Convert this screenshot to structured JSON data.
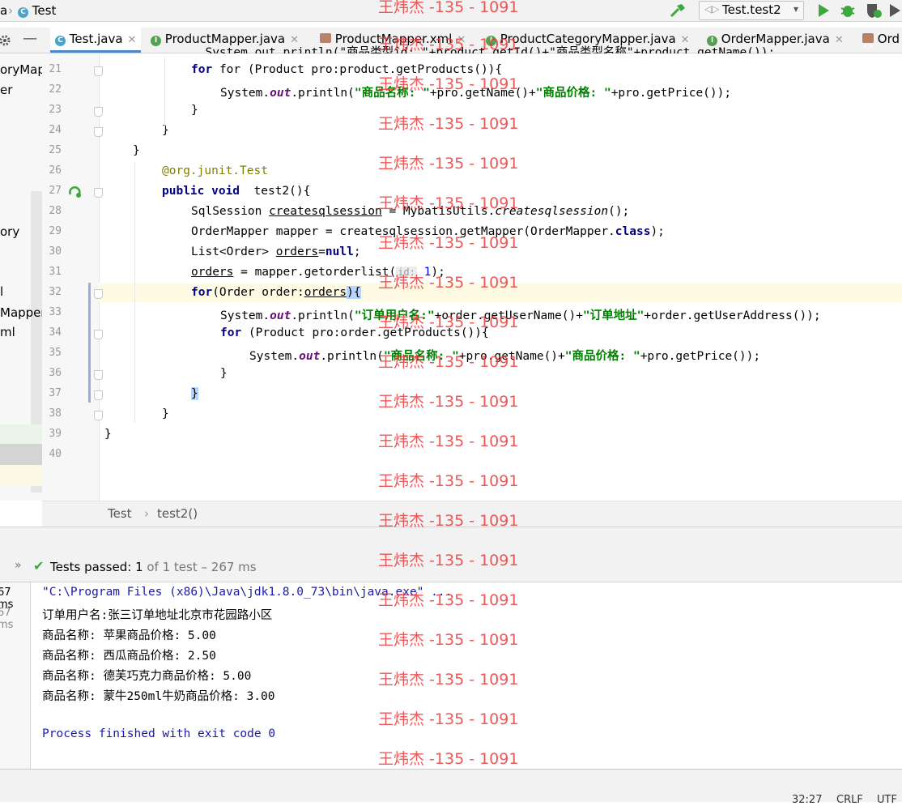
{
  "navbar": {
    "crumb_prev": "a",
    "crumb_file": "Test",
    "run_config": "Test.test2"
  },
  "tabs": [
    {
      "label": "Test.java",
      "icon": "java-class-icon"
    },
    {
      "label": "ProductMapper.java",
      "icon": "interface-icon"
    },
    {
      "label": "ProductMapper.xml",
      "icon": "xml-icon"
    },
    {
      "label": "ProductCategoryMapper.java",
      "icon": "interface-icon"
    },
    {
      "label": "OrderMapper.java",
      "icon": "interface-icon"
    },
    {
      "label": "Ord",
      "icon": "xml-icon"
    }
  ],
  "project_tree": [
    "oryMap",
    "er",
    "ory",
    "l",
    "Mapper",
    "ml"
  ],
  "code": {
    "line_numbers": [
      "21",
      "22",
      "23",
      "24",
      "25",
      "26",
      "27",
      "28",
      "29",
      "30",
      "31",
      "32",
      "33",
      "34",
      "35",
      "36",
      "37",
      "38",
      "39",
      "40"
    ],
    "partial_top": "System.out.println(\"商品类型id: \"+product.getId()+\"商品类型名称\"+product.getName());",
    "l21": "for (Product pro:product.getProducts()){",
    "l22a": "System.",
    "l22b": "out",
    "l22c": ".println(",
    "l22d": "\"商品名称: \"",
    "l22e": "+pro.getName()+",
    "l22f": "\"商品价格: \"",
    "l22g": "+pro.getPrice());",
    "l23": "}",
    "l24": "}",
    "l25": "}",
    "l26": "@org.junit.Test",
    "l27a": "public void",
    "l27b": "test2(){",
    "l28a": "SqlSession ",
    "l28b": "createsqlsession",
    "l28c": " = MybatisUtils.",
    "l28d": "createsqlsession",
    "l28e": "();",
    "l29a": "OrderMapper mapper = createsqlsession.getMapper(OrderMapper.",
    "l29b": "class",
    "l29c": ");",
    "l30a": "List<Order> ",
    "l30b": "orders",
    "l30c": "=",
    "l30d": "null",
    "l30e": ";",
    "l31a": "orders",
    "l31b": " = mapper.getorderlist(",
    "l31hint": "id:",
    "l31c": "1",
    "l31d": ");",
    "l32a": "for",
    "l32b": "(Order order:",
    "l32c": "orders",
    "l32d": "){",
    "l33a": "System.",
    "l33b": "out",
    "l33c": ".println(",
    "l33d": "\"订单用户名:\"",
    "l33e": "+order.getUserName()+",
    "l33f": "\"订单地址\"",
    "l33g": "+order.getUserAddress());",
    "l34a": "for",
    "l34b": " (Product pro:order.getProducts()){",
    "l35a": "System.",
    "l35b": "out",
    "l35c": ".println(",
    "l35d": "\"商品名称: \"",
    "l35e": "+pro.getName()+",
    "l35f": "\"商品价格: \"",
    "l35g": "+pro.getPrice());",
    "l36": "}",
    "l37": "}",
    "l38": "}",
    "l39": "}"
  },
  "breadcrumb": {
    "cls": "Test",
    "sep": "›",
    "method": "test2()"
  },
  "tests": {
    "label": "Tests passed:",
    "passed": "1",
    "of_text": "of 1 test",
    "duration": "– 267 ms"
  },
  "left_times": [
    "67 ms",
    "67 ms"
  ],
  "console": {
    "cmd": "\"C:\\Program Files (x86)\\Java\\jdk1.8.0_73\\bin\\java.exe\" ...",
    "lines": [
      "订单用户名:张三订单地址北京市花园路小区",
      "商品名称: 苹果商品价格: 5.00",
      "商品名称: 西瓜商品价格: 2.50",
      "商品名称: 德芙巧克力商品价格: 5.00",
      "商品名称: 蒙牛250ml牛奶商品价格: 3.00"
    ],
    "finished": "Process finished with exit code 0"
  },
  "status": {
    "position": "32:27",
    "line_sep": "CRLF",
    "encoding": "UTF"
  },
  "watermark": "王炜杰 -135 - 1091",
  "colors": {
    "keyword": "#000080",
    "string": "#008000",
    "annotation": "#808000",
    "field": "#660e7a",
    "run_green": "#3da83d",
    "watermark": "#ea3b3b"
  }
}
